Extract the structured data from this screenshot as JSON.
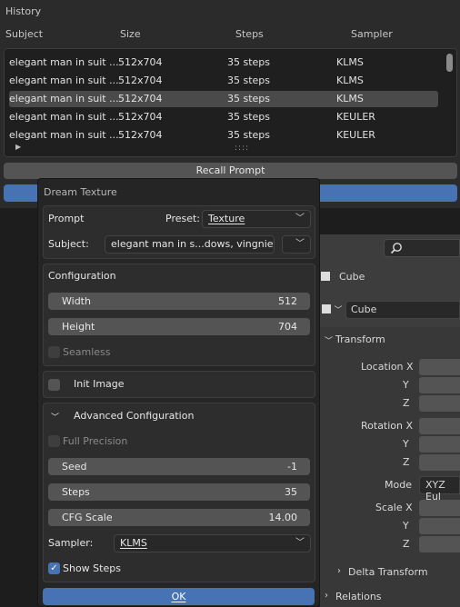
{
  "history": {
    "title": "History",
    "columns": [
      "Subject",
      "Size",
      "Steps",
      "Sampler"
    ],
    "rows": [
      {
        "subject": "elegant man in suit ...",
        "size": "512x704",
        "steps": "35 steps",
        "sampler": "KLMS"
      },
      {
        "subject": "elegant man in suit ...",
        "size": "512x704",
        "steps": "35 steps",
        "sampler": "KLMS"
      },
      {
        "subject": "elegant man in suit ...",
        "size": "512x704",
        "steps": "35 steps",
        "sampler": "KLMS"
      },
      {
        "subject": "elegant man in suit ...",
        "size": "512x704",
        "steps": "35 steps",
        "sampler": "KEULER"
      },
      {
        "subject": "elegant man in suit ...",
        "size": "512x704",
        "steps": "35 steps",
        "sampler": "KEULER"
      }
    ],
    "dots": "::::",
    "recall_label": "Recall Prompt"
  },
  "background": {
    "object_name": "Cube",
    "data_name": "Cube",
    "transform_label": "Transform",
    "location_x": "Location X",
    "rotation_x": "Rotation X",
    "scale_x": "Scale X",
    "y": "Y",
    "z": "Z",
    "mode_label": "Mode",
    "mode_value": "XYZ Eul",
    "delta_transform": "Delta Transform",
    "relations": "Relations"
  },
  "dialog": {
    "title": "Dream Texture",
    "prompt_label": "Prompt",
    "preset_label": "Preset:",
    "preset_value": "Texture",
    "subject_label": "Subject:",
    "subject_value": "elegant man in s...dows, vingniette",
    "configuration_label": "Configuration",
    "width_label": "Width",
    "width_value": "512",
    "height_label": "Height",
    "height_value": "704",
    "seamless_label": "Seamless",
    "init_image_label": "Init Image",
    "advanced_label": "Advanced Configuration",
    "full_precision_label": "Full Precision",
    "seed_label": "Seed",
    "seed_value": "-1",
    "steps_label": "Steps",
    "steps_value": "35",
    "cfg_label": "CFG Scale",
    "cfg_value": "14.00",
    "sampler_label": "Sampler:",
    "sampler_value": "KLMS",
    "show_steps_label": "Show Steps",
    "show_steps_checked": true,
    "ok_label": "OK"
  }
}
